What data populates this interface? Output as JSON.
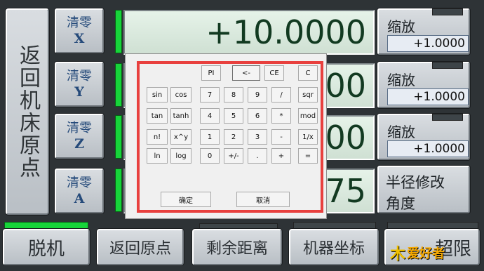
{
  "home_button_label": "返回机床原点",
  "zero_buttons": [
    {
      "line1": "清零",
      "axis": "X"
    },
    {
      "line1": "清零",
      "axis": "Y"
    },
    {
      "line1": "清零",
      "axis": "Z"
    },
    {
      "line1": "清零",
      "axis": "A"
    }
  ],
  "coords": {
    "x": "+10.0000",
    "y": "00",
    "z": "00",
    "a": "75"
  },
  "zoom_panels": [
    {
      "label": "缩放",
      "value": "+1.0000"
    },
    {
      "label": "缩放",
      "value": "+1.0000"
    },
    {
      "label": "缩放",
      "value": "+1.0000"
    }
  ],
  "radius_panel": {
    "line1": "半径修改",
    "line2": "角度"
  },
  "bottom_buttons": {
    "offline": "脱机",
    "return_origin": "返回原点",
    "remaining": "剩余距离",
    "machine_coords": "机器坐标",
    "overtravel": "超限"
  },
  "calculator": {
    "row0": [
      "PI",
      "<-",
      "CE",
      "C"
    ],
    "row1": [
      "sin",
      "cos",
      "7",
      "8",
      "9",
      "/",
      "sqr"
    ],
    "row2": [
      "tan",
      "tanh",
      "4",
      "5",
      "6",
      "*",
      "mod"
    ],
    "row3": [
      "n!",
      "x^y",
      "1",
      "2",
      "3",
      "-",
      "1/x"
    ],
    "row4": [
      "ln",
      "log",
      "0",
      "+/-",
      ".",
      "+",
      "="
    ],
    "ok": "确定",
    "cancel": "取消"
  },
  "logo": {
    "mark": "木",
    "text": "爱好者"
  }
}
